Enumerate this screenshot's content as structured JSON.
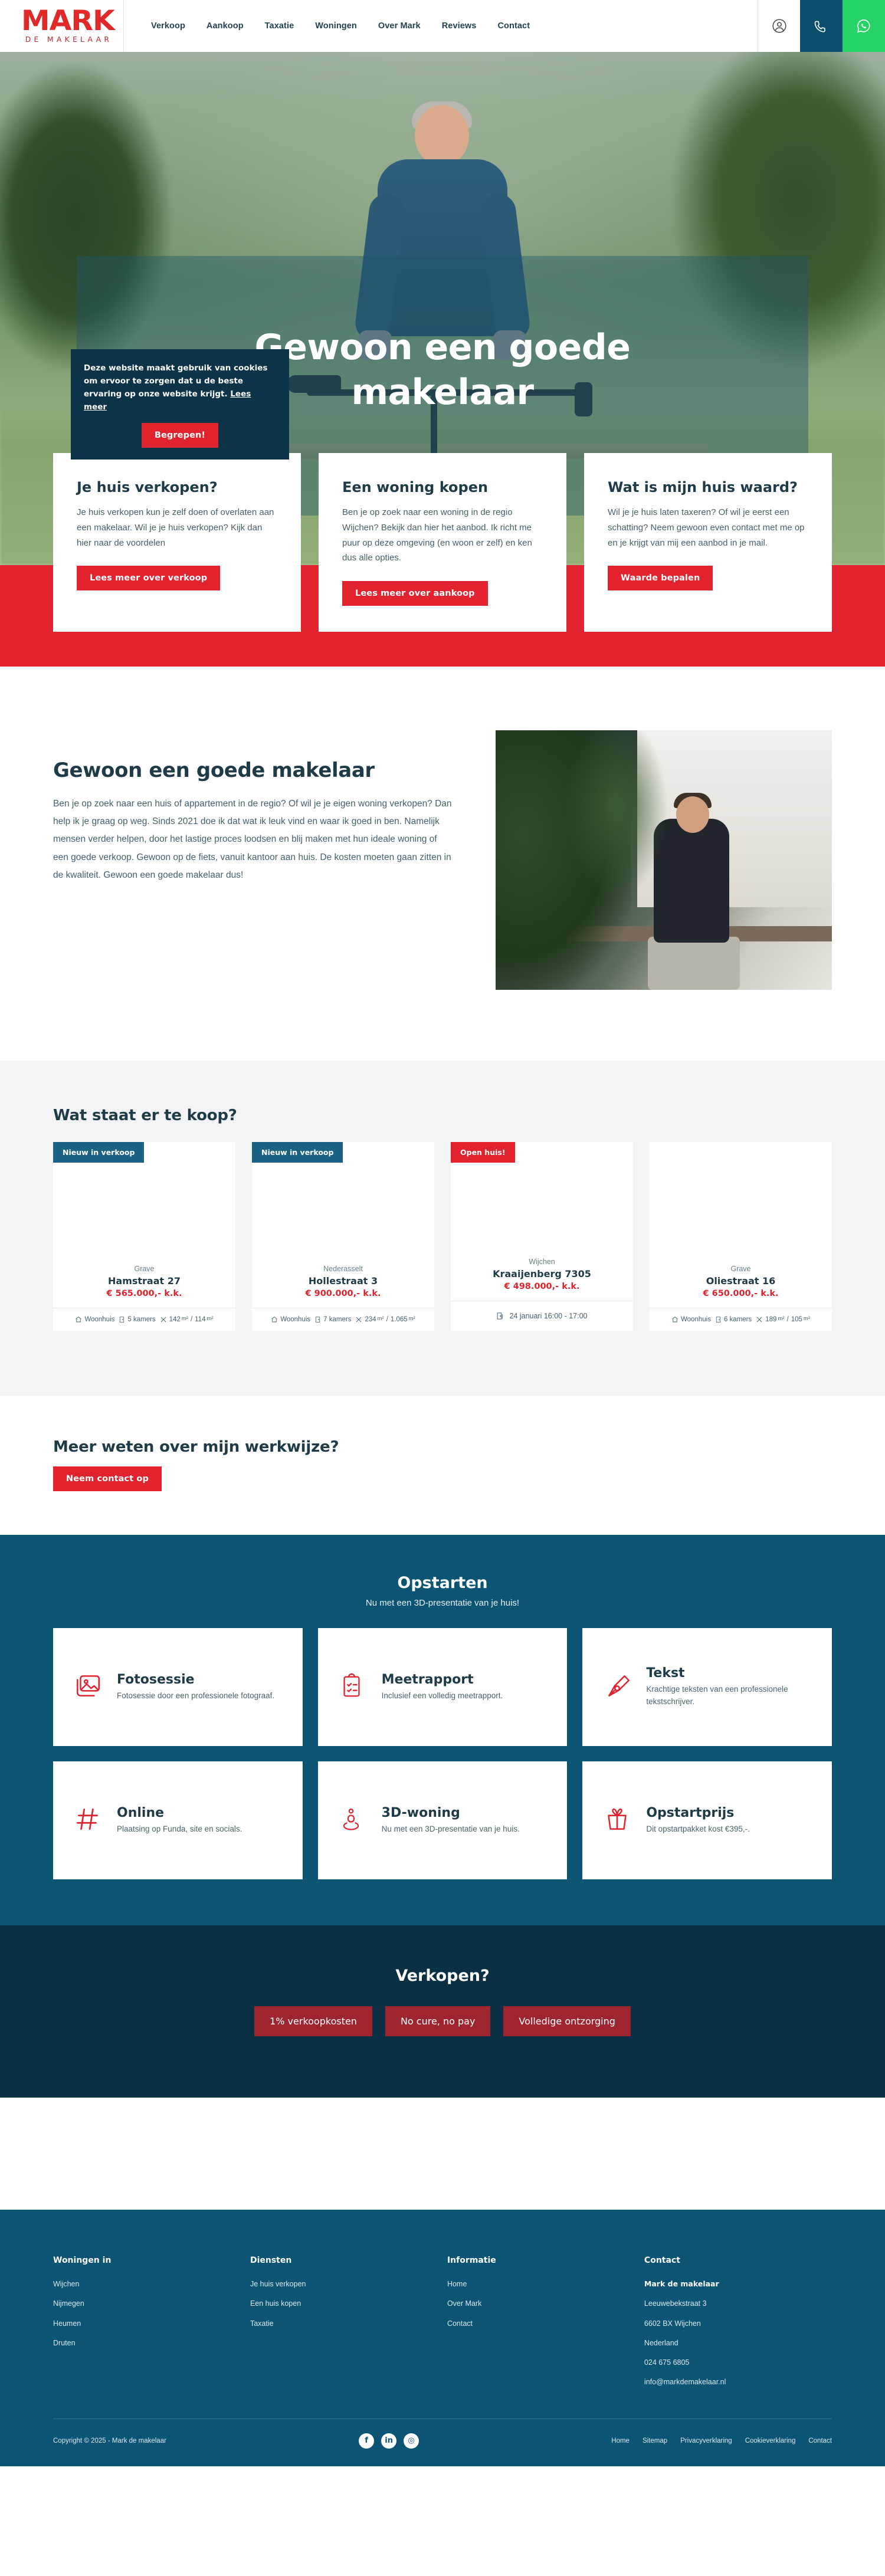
{
  "header": {
    "logo_main": "MARK",
    "logo_sub": "DE MAKELAAR",
    "nav": [
      {
        "label": "Verkoop"
      },
      {
        "label": "Aankoop"
      },
      {
        "label": "Taxatie"
      },
      {
        "label": "Woningen"
      },
      {
        "label": "Over Mark"
      },
      {
        "label": "Reviews"
      },
      {
        "label": "Contact"
      }
    ],
    "actions": {
      "account_icon": "user-circle-icon",
      "phone_icon": "phone-icon",
      "whatsapp_icon": "whatsapp-icon"
    }
  },
  "hero": {
    "title": "Gewoon een goede makelaar"
  },
  "cookie": {
    "text": "Deze website maakt gebruik van cookies om ervoor te zorgen dat u de beste ervaring op onze website krijgt.",
    "link": "Lees meer",
    "accept": "Begrepen!"
  },
  "cards": [
    {
      "title": "Je huis verkopen?",
      "body": "Je huis verkopen kun je zelf doen of overlaten aan een makelaar. Wil je je huis verkopen? Kijk dan hier naar de voordelen",
      "button": "Lees meer over verkoop"
    },
    {
      "title": "Een woning kopen",
      "body": "Ben je op zoek naar een woning in de regio Wijchen? Bekijk dan hier het aanbod. Ik richt me puur op deze omgeving (en woon er zelf) en ken dus alle opties.",
      "button": "Lees meer over aankoop"
    },
    {
      "title": "Wat is mijn huis waard?",
      "body": "Wil je je huis laten taxeren? Of wil je eerst een schatting? Neem gewoon even contact met me op en je krijgt van mij een aanbod in je mail.",
      "button": "Waarde bepalen"
    }
  ],
  "about": {
    "title": "Gewoon een goede makelaar",
    "body": "Ben je op zoek naar een huis of appartement in de regio? Of wil je je eigen woning verkopen? Dan help ik je graag op weg. Sinds 2021 doe ik dat wat ik leuk vind en waar ik goed in ben. Namelijk mensen verder helpen, door het lastige proces loodsen en blij maken met hun ideale woning of een goede verkoop. Gewoon op de fiets, vanuit kantoor aan huis. De kosten moeten gaan zitten in de kwaliteit. Gewoon een goede makelaar dus!"
  },
  "listings": {
    "title": "Wat staat er te koop?",
    "items": [
      {
        "badge": "Nieuw in verkoop",
        "badge_type": "blue",
        "city": "Grave",
        "address": "Hamstraat 27",
        "price": "€ 565.000,- k.k.",
        "type": "Woonhuis",
        "rooms": "5 kamers",
        "area_living": "142",
        "area_plot": "114",
        "area_unit": "m²"
      },
      {
        "badge": "Nieuw in verkoop",
        "badge_type": "blue",
        "city": "Nederasselt",
        "address": "Hollestraat 3",
        "price": "€ 900.000,- k.k.",
        "type": "Woonhuis",
        "rooms": "7 kamers",
        "area_living": "234",
        "area_plot": "1.065",
        "area_unit": "m²"
      },
      {
        "badge": "Open huis!",
        "badge_type": "red",
        "city": "Wijchen",
        "address": "Kraaijenberg 7305",
        "price": "€ 498.000,- k.k.",
        "open_house": "24 januari 16:00 - 17:00"
      },
      {
        "badge": "",
        "badge_type": "none",
        "city": "Grave",
        "address": "Oliestraat 16",
        "price": "€ 650.000,- k.k.",
        "type": "Woonhuis",
        "rooms": "6 kamers",
        "area_living": "189",
        "area_plot": "105",
        "area_unit": "m²"
      }
    ]
  },
  "werkwijze": {
    "title": "Meer weten over mijn werkwijze?",
    "button": "Neem contact op"
  },
  "opstarten": {
    "title": "Opstarten",
    "subtitle": "Nu met een 3D-presentatie van je huis!",
    "features": [
      {
        "icon": "image-icon",
        "title": "Fotosessie",
        "desc": "Fotosessie door een professionele fotograaf."
      },
      {
        "icon": "clipboard-check-icon",
        "title": "Meetrapport",
        "desc": "Inclusief een volledig meetrapport."
      },
      {
        "icon": "pen-nib-icon",
        "title": "Tekst",
        "desc": "Krachtige teksten van een professionele tekstschrijver."
      },
      {
        "icon": "hashtag-icon",
        "title": "Online",
        "desc": "Plaatsing op Funda, site en socials."
      },
      {
        "icon": "location-pin-icon",
        "title": "3D-woning",
        "desc": "Nu met een 3D-presentatie van je huis."
      },
      {
        "icon": "gift-box-icon",
        "title": "Opstartprijs",
        "desc": "Dit opstartpakket kost €395,-."
      }
    ]
  },
  "verkopen": {
    "title": "Verkopen?",
    "pills": [
      "1% verkoopkosten",
      "No cure, no pay",
      "Volledige ontzorging"
    ]
  },
  "footer": {
    "columns": [
      {
        "heading": "Woningen in",
        "links": [
          "Wijchen",
          "Nijmegen",
          "Heumen",
          "Druten"
        ]
      },
      {
        "heading": "Diensten",
        "links": [
          "Je huis verkopen",
          "Een huis kopen",
          "Taxatie"
        ]
      },
      {
        "heading": "Informatie",
        "links": [
          "Home",
          "Over Mark",
          "Contact"
        ]
      }
    ],
    "contact": {
      "heading": "Contact",
      "name": "Mark de makelaar",
      "street": "Leeuwebekstraat 3",
      "postal": "6602 BX Wijchen",
      "country": "Nederland",
      "phone": "024 675 6805",
      "email": "info@markdemakelaar.nl"
    },
    "copyright": "Copyright © 2025 - Mark de makelaar",
    "social": [
      {
        "name": "facebook-icon",
        "glyph": "f"
      },
      {
        "name": "linkedin-icon",
        "glyph": "in"
      },
      {
        "name": "instagram-icon",
        "glyph": "◎"
      }
    ],
    "bottom_links": [
      "Home",
      "Sitemap",
      "Privacyverklaring",
      "Cookieverklaring",
      "Contact"
    ]
  },
  "colors": {
    "red": "#e0232e",
    "dark_blue": "#0b3044",
    "teal": "#0b5474",
    "badge_blue": "#1a6183",
    "whatsapp_green": "#25d366"
  }
}
